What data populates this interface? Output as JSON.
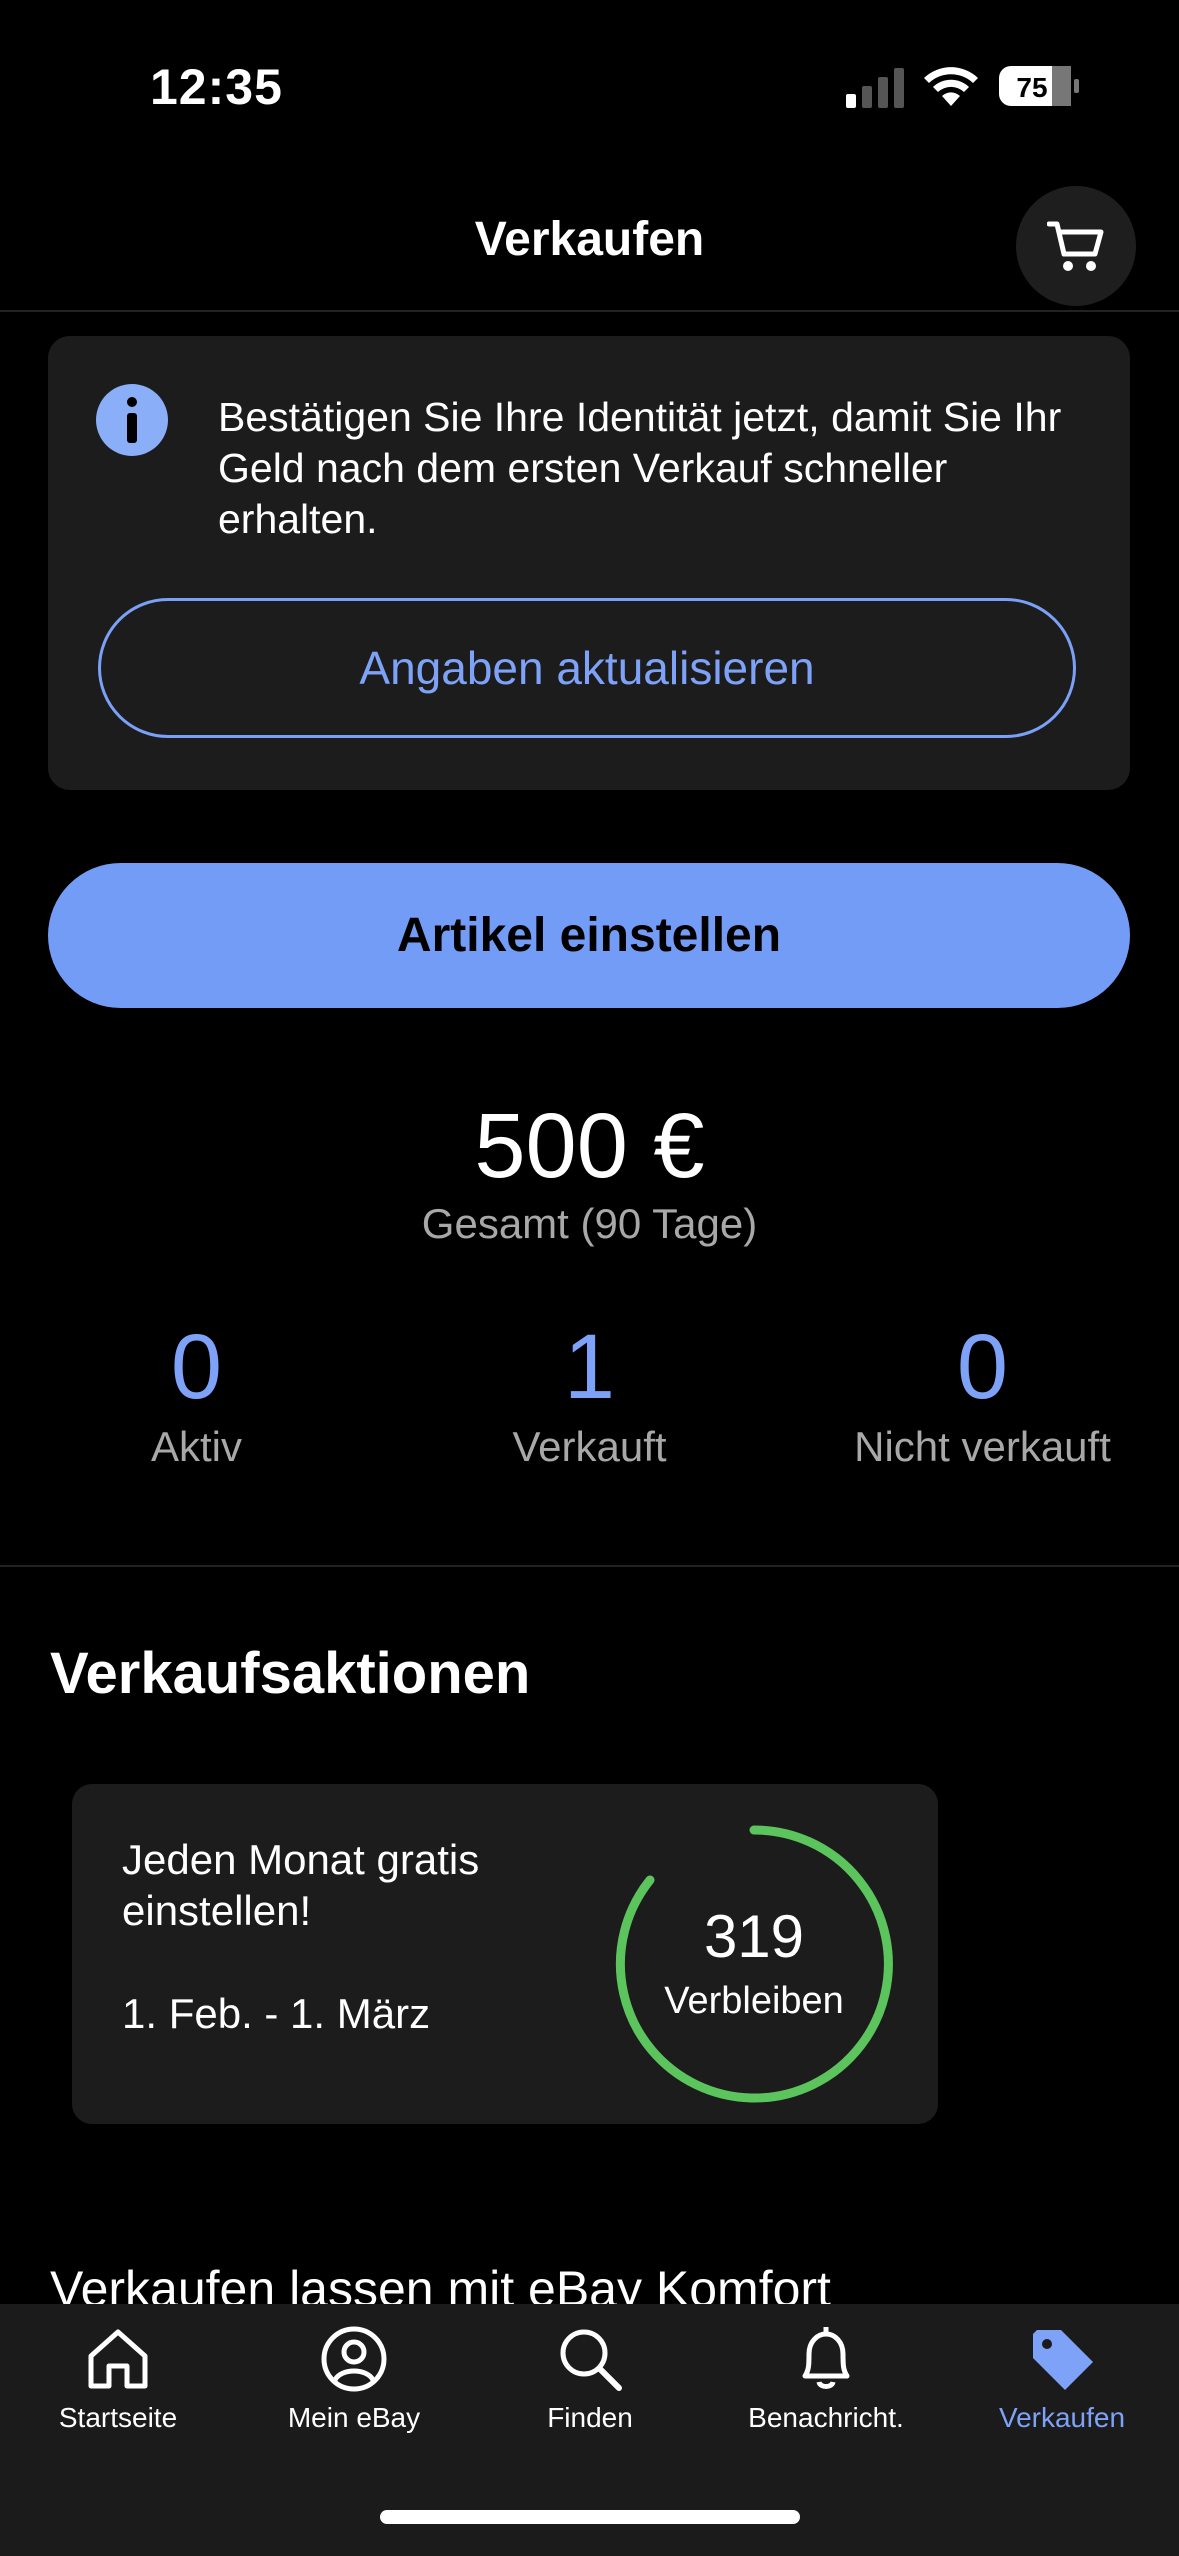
{
  "status_bar": {
    "time": "12:35",
    "battery": "75"
  },
  "header": {
    "title": "Verkaufen",
    "cart_icon": "cart-icon"
  },
  "info_card": {
    "icon": "info-icon",
    "message": "Bestätigen Sie Ihre Identität jetzt, damit Sie Ihr Geld nach dem ersten Verkauf schneller erhalten.",
    "button_label": "Angaben aktualisieren"
  },
  "primary_action": {
    "label": "Artikel einstellen"
  },
  "totals": {
    "amount": "500 €",
    "label": "Gesamt (90 Tage)"
  },
  "stats": [
    {
      "value": "0",
      "label": "Aktiv"
    },
    {
      "value": "1",
      "label": "Verkauft"
    },
    {
      "value": "0",
      "label": "Nicht verkauft"
    }
  ],
  "promotions": {
    "title": "Verkaufsaktionen",
    "card": {
      "title": "Jeden Monat gratis einstellen!",
      "date_range": "1. Feb. - 1. März",
      "remaining_count": "319",
      "remaining_label": "Verbleiben",
      "ring_color": "#5cc45c"
    }
  },
  "next_section": {
    "title": "Verkaufen lassen mit eBay Komfort"
  },
  "tab_bar": {
    "items": [
      {
        "label": "Startseite",
        "icon": "home-icon"
      },
      {
        "label": "Mein eBay",
        "icon": "profile-icon"
      },
      {
        "label": "Finden",
        "icon": "search-icon"
      },
      {
        "label": "Benachricht.",
        "icon": "bell-icon"
      },
      {
        "label": "Verkaufen",
        "icon": "tag-icon",
        "active": true
      }
    ]
  },
  "colors": {
    "accent": "#729cf5",
    "background": "#000000",
    "card": "#1c1c1c",
    "ring": "#5cc45c"
  }
}
